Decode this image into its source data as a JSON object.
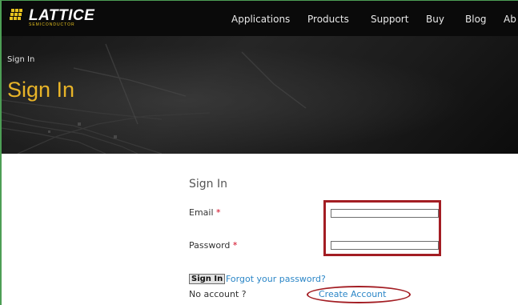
{
  "brand": {
    "name": "LATTICE",
    "subtitle": "SEMICONDUCTOR"
  },
  "nav": {
    "items": [
      "Applications",
      "Products",
      "Support",
      "Buy",
      "Blog",
      "Ab"
    ]
  },
  "banner": {
    "breadcrumb": "Sign In",
    "title": "Sign In"
  },
  "form": {
    "title": "Sign In",
    "email_label": "Email",
    "password_label": "Password",
    "required_marker": "*",
    "email_value": "",
    "password_value": "",
    "signin_button": "Sign In",
    "forgot_link": "Forgot your password?",
    "no_account_text": "No account ?",
    "create_account_link": "Create Account"
  },
  "colors": {
    "nav_bg": "#0a0a0a",
    "brand_yellow": "#e6c21e",
    "title_gold": "#e8b428",
    "link_blue": "#2b86c7",
    "required_red": "#d0021b",
    "annotation_red": "#a31d23",
    "frame_green": "#4d9e55"
  }
}
